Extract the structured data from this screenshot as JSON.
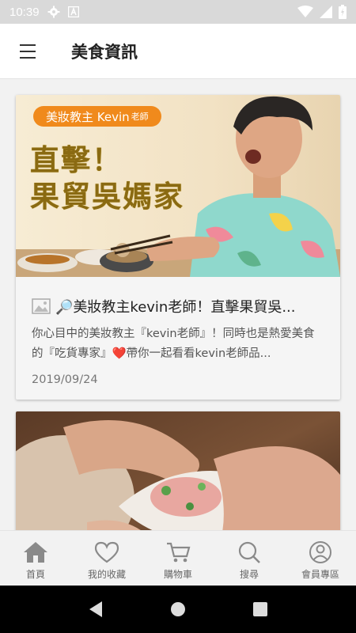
{
  "status_bar": {
    "time": "10:39"
  },
  "app_bar": {
    "title": "美食資訊"
  },
  "feed": {
    "cards": [
      {
        "image": {
          "badge_main": "美妝教主 Kevin",
          "badge_small": "老師",
          "headline_line1": "直擊！",
          "headline_line2": "果貿吳媽家"
        },
        "title": "🔎美妝教主kevin老師！直擊果貿吳...",
        "description": "你心目中的美妝教主『kevin老師』！同時也是熱愛美食的『吃貨專家』❤️帶你一起看看kevin老師品...",
        "date": "2019/09/24"
      }
    ]
  },
  "bottom_nav": {
    "items": [
      {
        "label": "首頁",
        "icon": "home-icon"
      },
      {
        "label": "我的收藏",
        "icon": "heart-icon"
      },
      {
        "label": "購物車",
        "icon": "cart-icon"
      },
      {
        "label": "搜尋",
        "icon": "search-icon"
      },
      {
        "label": "會員專區",
        "icon": "user-icon"
      }
    ]
  },
  "colors": {
    "accent_orange": "#f08a1c",
    "headline_gold": "#8a6a12",
    "nav_icon": "#8a8a8a"
  }
}
